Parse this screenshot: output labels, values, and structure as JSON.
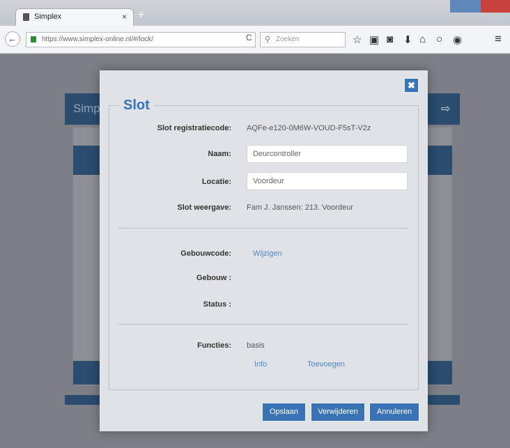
{
  "browser": {
    "tab_title": "Simplex",
    "tab_close": "×",
    "new_tab": "+",
    "back": "←",
    "url": "https://www.simplex-online.nl/#/lock/",
    "reload": "C",
    "search_placeholder": "Zoeken",
    "search_icon": "⚲",
    "toolbar_icons": [
      {
        "name": "bookmark-star-icon",
        "glyph": "☆"
      },
      {
        "name": "reading-list-icon",
        "glyph": "▣"
      },
      {
        "name": "pocket-icon",
        "glyph": "◙"
      },
      {
        "name": "download-icon",
        "glyph": "⬇"
      },
      {
        "name": "home-icon",
        "glyph": "⌂"
      },
      {
        "name": "sync-icon",
        "glyph": "○"
      },
      {
        "name": "extension-icon",
        "glyph": "◉"
      },
      {
        "name": "menu-icon",
        "glyph": "≡"
      }
    ]
  },
  "page": {
    "title": "Simp",
    "logout_icon": "⇨"
  },
  "modal": {
    "close_glyph": "✖",
    "legend": "Slot",
    "fields": {
      "registration_label": "Slot registratiecode:",
      "registration_value": "AQFe-e120-0M6W-VOUD-F5sT-V2z",
      "name_label": "Naam:",
      "name_value": "Deurcontroller",
      "location_label": "Locatie:",
      "location_value": "Voordeur",
      "display_label": "Slot weergave:",
      "display_value": "Fam J. Janssen: 213. Voordeur",
      "building_code_label": "Gebouwcode:",
      "building_code_link": "Wijzigen",
      "building_label": "Gebouw :",
      "status_label": "Status :",
      "functions_label": "Functies:",
      "functions_value": "basis",
      "info_link": "Info",
      "add_link": "Toevoegen"
    },
    "buttons": {
      "save": "Opslaan",
      "delete": "Verwijderen",
      "cancel": "Annuleren"
    }
  },
  "colors": {
    "accent": "#3a73b5",
    "navy": "#2b4c6e",
    "overlay": "#7c7f85"
  }
}
